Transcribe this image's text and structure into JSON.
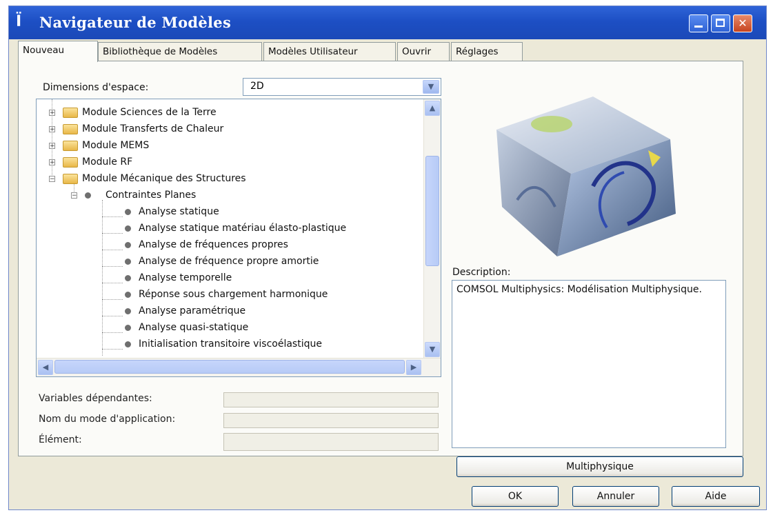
{
  "window": {
    "title": "Navigateur de Modèles"
  },
  "tabs": [
    "Nouveau",
    "Bibliothèque de Modèles",
    "Modèles Utilisateur",
    "Ouvrir",
    "Réglages"
  ],
  "space": {
    "label": "Dimensions d'espace:",
    "value": "2D"
  },
  "tree": {
    "modules": [
      "Module Sciences de la Terre",
      "Module Transferts de Chaleur",
      "Module MEMS",
      "Module RF",
      "Module Mécanique des Structures"
    ],
    "group": "Contraintes Planes",
    "analyses": [
      "Analyse statique",
      "Analyse statique matériau élasto-plastique",
      "Analyse de fréquences propres",
      "Analyse de fréquence propre amortie",
      "Analyse temporelle",
      "Réponse sous chargement harmonique",
      "Analyse paramétrique",
      "Analyse quasi-statique",
      "Initialisation transitoire viscoélastique"
    ]
  },
  "fields": {
    "dependent_vars": "Variables dépendantes:",
    "app_mode_name": "Nom du mode d'application:",
    "element": "Élément:"
  },
  "description": {
    "label": "Description:",
    "text": "COMSOL Multiphysics: Modélisation Multiphysique."
  },
  "buttons": {
    "multiphysics": "Multiphysique",
    "ok": "OK",
    "cancel": "Annuler",
    "help": "Aide"
  }
}
